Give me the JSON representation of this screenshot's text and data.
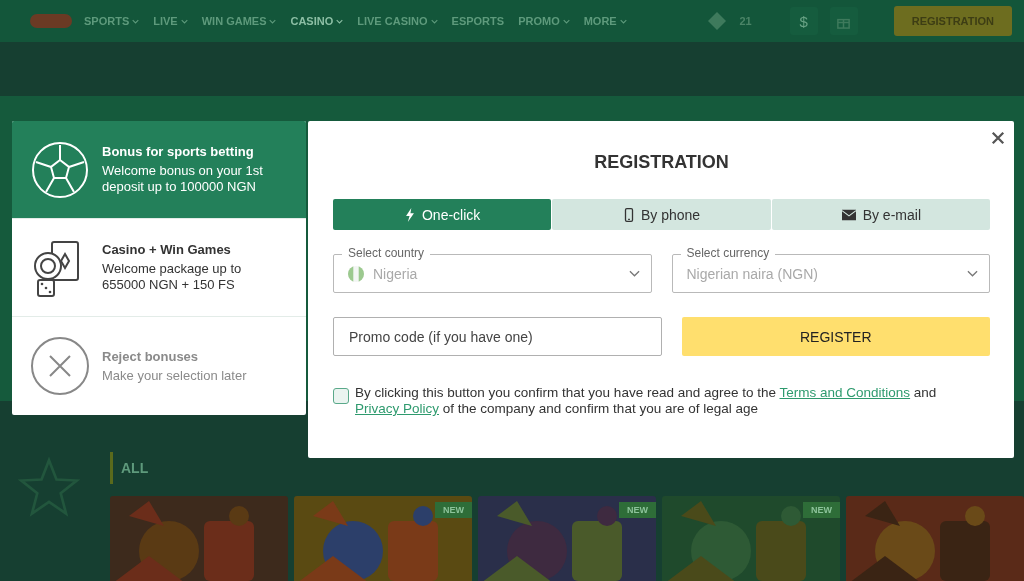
{
  "header": {
    "nav": [
      {
        "label": "SPORTS",
        "dropdown": true,
        "selected": false
      },
      {
        "label": "LIVE",
        "dropdown": true,
        "selected": false
      },
      {
        "label": "WIN GAMES",
        "dropdown": true,
        "selected": false
      },
      {
        "label": "CASINO",
        "dropdown": true,
        "selected": true
      },
      {
        "label": "LIVE CASINO",
        "dropdown": true,
        "selected": false
      },
      {
        "label": "ESPORTS",
        "dropdown": false,
        "selected": false
      },
      {
        "label": "PROMO",
        "dropdown": true,
        "selected": false
      },
      {
        "label": "MORE",
        "dropdown": true,
        "selected": false
      }
    ],
    "counter": "21",
    "currency_button": "$",
    "register_button": "REGISTRATION"
  },
  "games": {
    "tab": "ALL",
    "tiles": [
      {
        "kind": "picture"
      },
      {
        "kind": "picture",
        "badge": "NEW"
      },
      {
        "kind": "picture",
        "badge": "NEW"
      },
      {
        "kind": "picture",
        "badge": "NEW"
      },
      {
        "kind": "picture"
      }
    ]
  },
  "bonus_panel": {
    "items": [
      {
        "kind": "sports",
        "selected": true,
        "title": "Bonus for sports betting",
        "text": "Welcome bonus on your 1st deposit up to 100000 NGN"
      },
      {
        "kind": "casino",
        "selected": false,
        "title": "Casino + Win Games",
        "text": "Welcome package up to 655000 NGN + 150 FS"
      },
      {
        "kind": "reject",
        "selected": false,
        "title": "Reject bonuses",
        "text": "Make your selection later"
      }
    ]
  },
  "modal": {
    "title": "REGISTRATION",
    "tabs": [
      {
        "kind": "bolt",
        "label": "One-click",
        "selected": true
      },
      {
        "kind": "phone",
        "label": "By phone",
        "selected": false
      },
      {
        "kind": "mail",
        "label": "By e-mail",
        "selected": false
      }
    ],
    "country": {
      "label": "Select country",
      "value": "Nigeria"
    },
    "currency": {
      "label": "Select currency",
      "value": "Nigerian naira (NGN)"
    },
    "promo": {
      "placeholder": "Promo code (if you have one)"
    },
    "register_button": "REGISTER",
    "consent": {
      "checked": false,
      "parts": [
        {
          "kind": "text",
          "text": "By clicking this button you confirm that you have read and agree to the "
        },
        {
          "kind": "link",
          "text": "Terms and Conditions"
        },
        {
          "kind": "text",
          "text": " and "
        },
        {
          "kind": "link",
          "text": "Privacy Policy"
        },
        {
          "kind": "text",
          "text": " of the company and confirm that you are of legal age"
        }
      ]
    }
  }
}
